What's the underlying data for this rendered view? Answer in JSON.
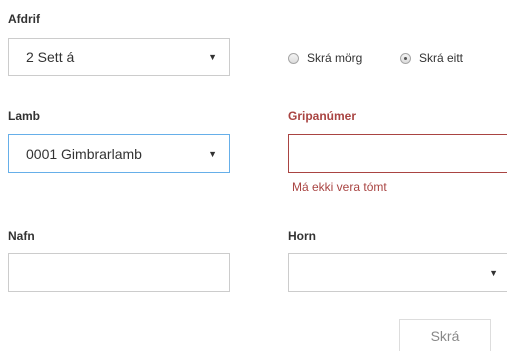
{
  "afdrif": {
    "label": "Afdrif",
    "selected": "2 Sett á"
  },
  "mode": {
    "option_many": "Skrá mörg",
    "option_one": "Skrá eitt",
    "selected": "option_one"
  },
  "lamb": {
    "label": "Lamb",
    "selected": "0001 Gimbrarlamb"
  },
  "gripanumer": {
    "label": "Gripanúmer",
    "value": "",
    "error": "Má ekki vera tómt"
  },
  "nafn": {
    "label": "Nafn",
    "value": ""
  },
  "horn": {
    "label": "Horn",
    "selected": ""
  },
  "actions": {
    "submit_label": "Skrá"
  },
  "icons": {
    "caret": "caret-down-icon",
    "radio": "radio-icon"
  },
  "colors": {
    "error": "#a94442",
    "focus_border": "#66afe9",
    "border": "#cccccc",
    "text": "#333333"
  }
}
